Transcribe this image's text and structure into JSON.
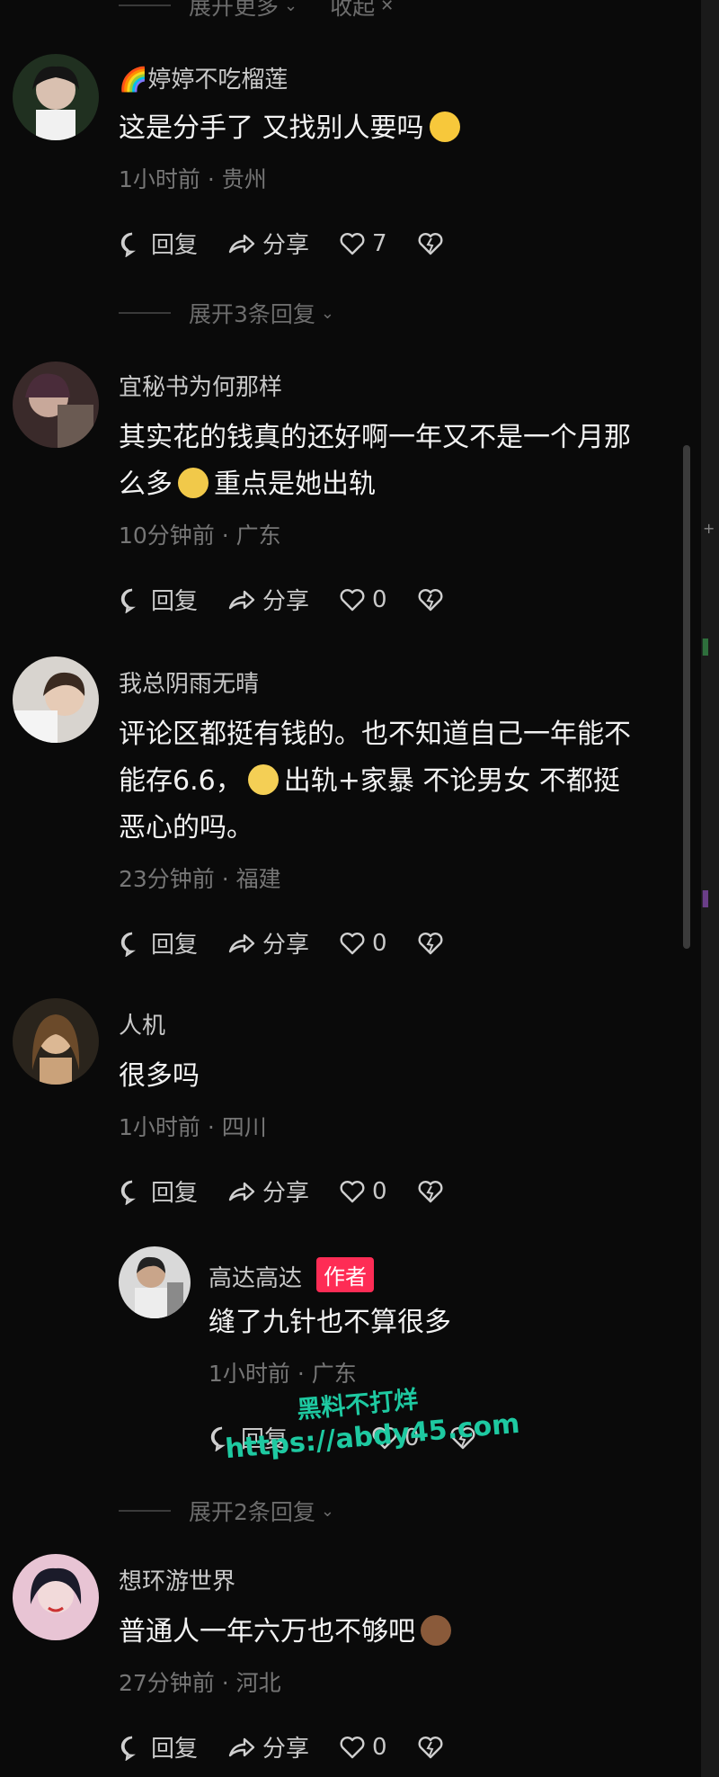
{
  "top_toggle": {
    "expand": "展开更多",
    "collapse": "收起"
  },
  "comments": [
    {
      "username": "婷婷不吃榴莲",
      "text_lines": [
        "这是分手了 又找别人要吗"
      ],
      "time": "1小时前 · 贵州",
      "reply_label": "回复",
      "share_label": "分享",
      "likes": "7",
      "expand_label": "展开3条回复"
    },
    {
      "username": "宜秘书为何那样",
      "text_lines": [
        "其实花的钱真的还好啊一年又不是一个月那",
        "么多",
        "重点是她出轨"
      ],
      "time": "10分钟前 · 广东",
      "reply_label": "回复",
      "share_label": "分享",
      "likes": "0"
    },
    {
      "username": "我总阴雨无晴",
      "text_lines": [
        "评论区都挺有钱的。也不知道自己一年能不",
        "能存6.6，",
        "出轨+家暴 不论男女 不都挺",
        "恶心的吗。"
      ],
      "time": "23分钟前 · 福建",
      "reply_label": "回复",
      "share_label": "分享",
      "likes": "0"
    },
    {
      "username": "人机",
      "text_lines": [
        "很多吗"
      ],
      "time": "1小时前 · 四川",
      "reply_label": "回复",
      "share_label": "分享",
      "likes": "0",
      "reply": {
        "username": "高达高达",
        "badge": "作者",
        "text": "缝了九针也不算很多",
        "time": "1小时前 · 广东",
        "reply_label": "回复",
        "likes": "0"
      },
      "expand_label": "展开2条回复"
    },
    {
      "username": "想环游世界",
      "text_lines": [
        "普通人一年六万也不够吧"
      ],
      "time": "27分钟前 · 河北",
      "reply_label": "回复",
      "share_label": "分享",
      "likes": "0"
    }
  ],
  "watermark": {
    "line1": "黑料不打烊",
    "line2": "https://abdy45.com"
  },
  "colors": {
    "background": "#0a0a0a",
    "badge": "#fe2c55",
    "watermark": "#1ec9a1"
  }
}
